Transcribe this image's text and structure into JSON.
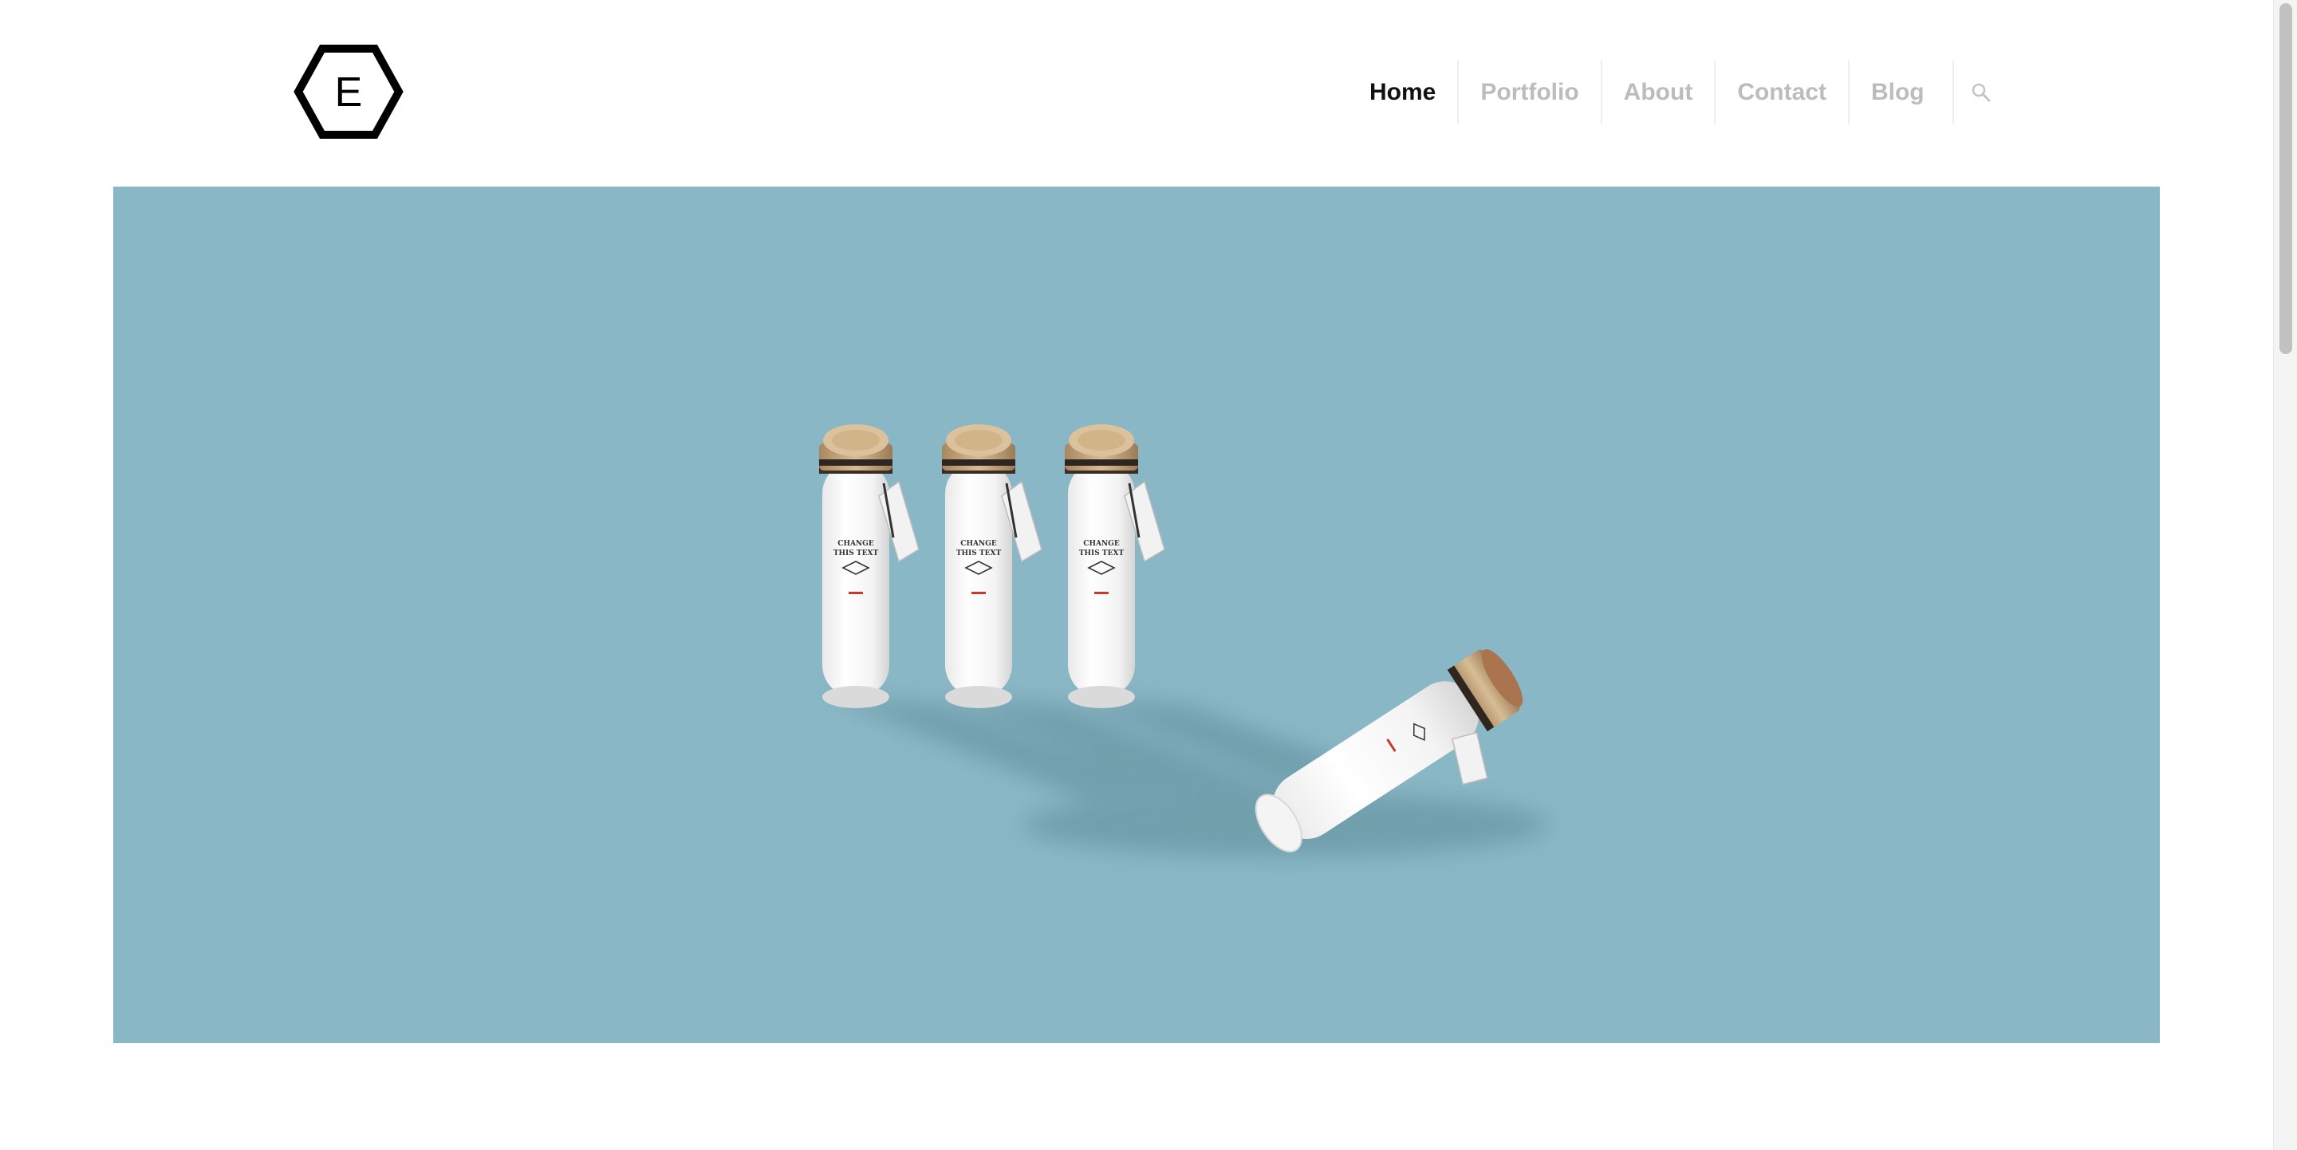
{
  "header": {
    "logo_letter": "E",
    "nav": [
      {
        "label": "Home",
        "active": true
      },
      {
        "label": "Portfolio",
        "active": false
      },
      {
        "label": "About",
        "active": false
      },
      {
        "label": "Contact",
        "active": false
      },
      {
        "label": "Blog",
        "active": false
      }
    ],
    "search_icon": "search-icon"
  },
  "hero": {
    "label_line1": "CHANGE",
    "label_line2": "THIS TEXT",
    "background_color": "#89b7c5"
  },
  "colors": {
    "nav_active": "#111111",
    "nav_inactive": "#bcbcbc",
    "accent_red": "#c8382b"
  }
}
